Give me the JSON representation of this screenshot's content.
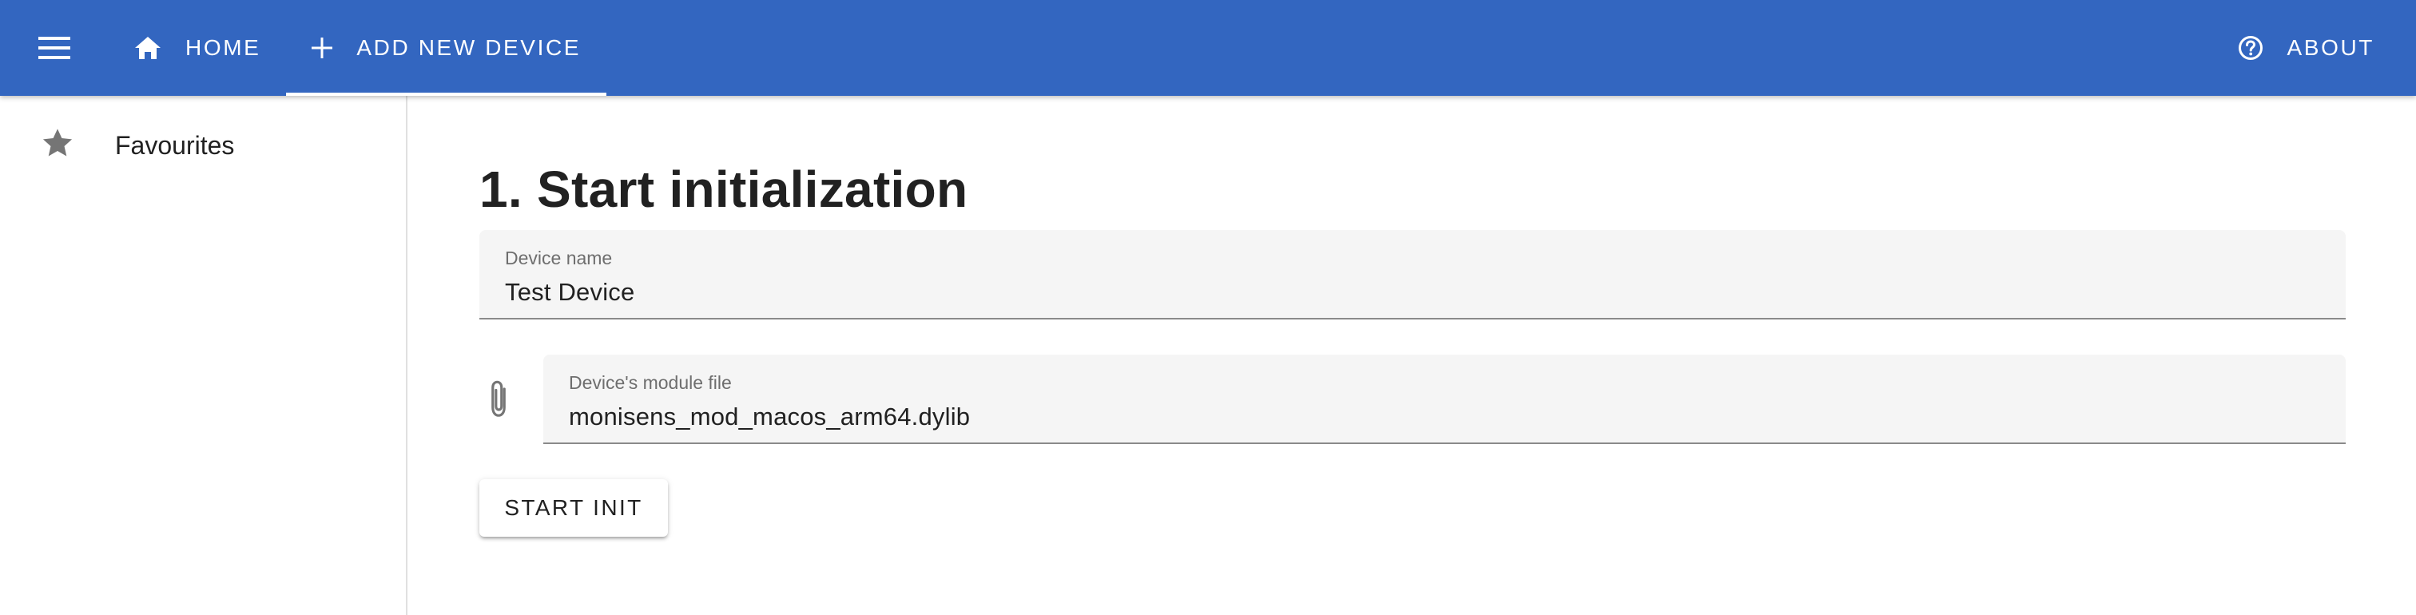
{
  "appbar": {
    "menu_icon": "menu-icon",
    "tabs": [
      {
        "label": "HOME",
        "icon": "home-icon",
        "active": false
      },
      {
        "label": "ADD NEW DEVICE",
        "icon": "plus-icon",
        "active": true
      }
    ],
    "about": {
      "label": "ABOUT",
      "icon": "help-circle-icon"
    },
    "colors": {
      "background": "#3366c0",
      "foreground": "#ffffff"
    }
  },
  "sidebar": {
    "items": [
      {
        "label": "Favourites",
        "icon": "star-icon"
      }
    ]
  },
  "main": {
    "title": "1. Start initialization",
    "device_name": {
      "label": "Device name",
      "value": "Test Device"
    },
    "module_file": {
      "label": "Device's module file",
      "value": "monisens_mod_macos_arm64.dylib",
      "icon": "paperclip-icon"
    },
    "start_button": {
      "label": "START INIT"
    }
  }
}
